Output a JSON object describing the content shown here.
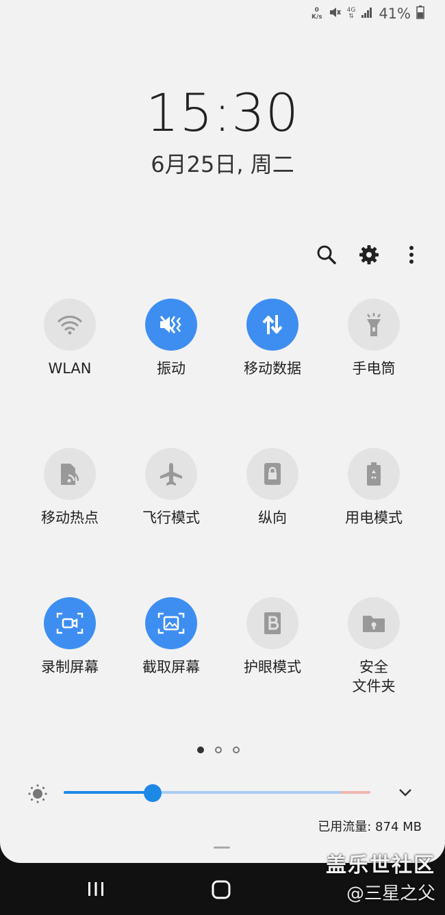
{
  "status_bar": {
    "net_speed_value": "0",
    "net_speed_unit": "K/s",
    "network_type": "4G",
    "battery_percent": "41%"
  },
  "lockscreen": {
    "time": "15:30",
    "date": "6月25日, 周二"
  },
  "toolbar": {
    "icons": [
      "search-icon",
      "gear-icon",
      "more-vert-icon"
    ]
  },
  "tiles": [
    {
      "label": "WLAN",
      "icon": "wifi-icon",
      "active": false
    },
    {
      "label": "振动",
      "icon": "vibrate-icon",
      "active": true
    },
    {
      "label": "移动数据",
      "icon": "mobile-data-icon",
      "active": true
    },
    {
      "label": "手电筒",
      "icon": "flashlight-icon",
      "active": false
    },
    {
      "label": "移动热点",
      "icon": "hotspot-icon",
      "active": false
    },
    {
      "label": "飞行模式",
      "icon": "airplane-icon",
      "active": false
    },
    {
      "label": "纵向",
      "icon": "portrait-lock-icon",
      "active": false
    },
    {
      "label": "用电模式",
      "icon": "power-mode-icon",
      "active": false
    },
    {
      "label": "录制屏幕",
      "icon": "screen-record-icon",
      "active": true
    },
    {
      "label": "截取屏幕",
      "icon": "screenshot-icon",
      "active": true
    },
    {
      "label": "护眼模式",
      "icon": "eye-comfort-icon",
      "active": false
    },
    {
      "label": "安全\n文件夹",
      "icon": "secure-folder-icon",
      "active": false
    }
  ],
  "pagination": {
    "pages": 3,
    "current": 1
  },
  "brightness": {
    "level": 0.29
  },
  "data_usage": "已用流量: 874 MB",
  "nav": {
    "buttons": [
      "recents-icon",
      "home-icon"
    ]
  },
  "watermark": {
    "line1": "盖乐世社区",
    "line2": "@三星之父"
  },
  "colors": {
    "accent": "#3e8ef2",
    "panel_bg": "#f2f2f2",
    "tile_off": "#e3e3e3"
  }
}
